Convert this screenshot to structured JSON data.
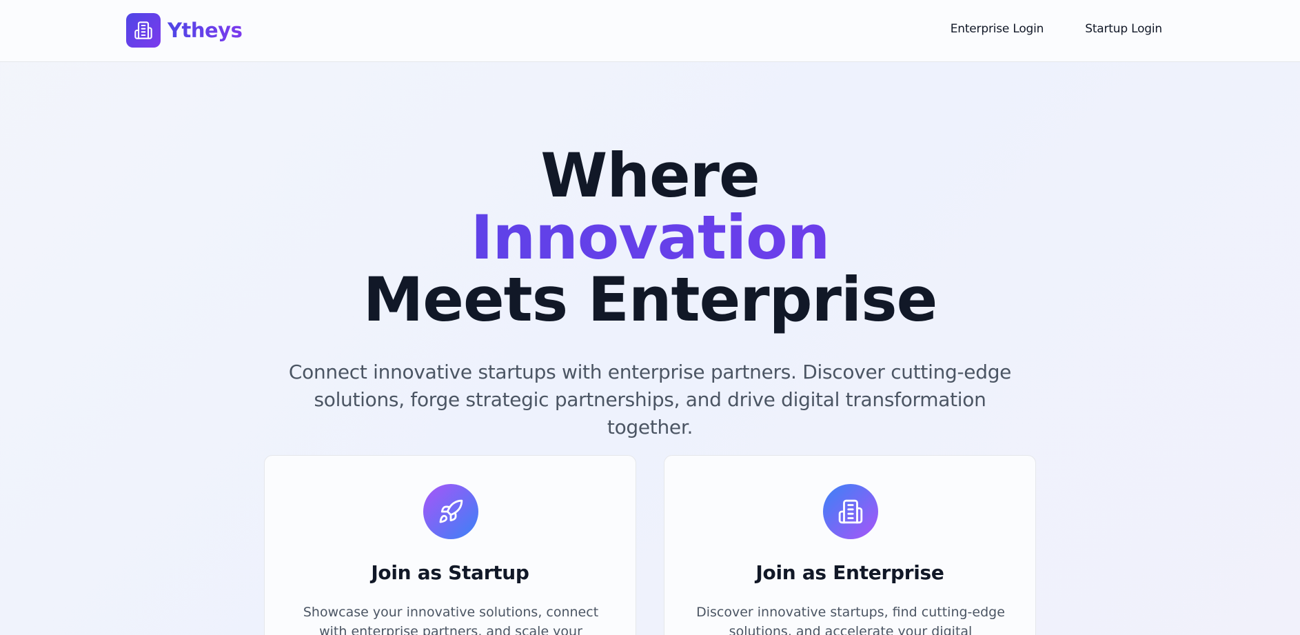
{
  "brand": {
    "name": "Ytheys",
    "logo_icon": "building-icon"
  },
  "nav": {
    "enterprise_login": "Enterprise Login",
    "startup_login": "Startup Login"
  },
  "hero": {
    "line1": "Where",
    "line2": "Innovation",
    "line3": "Meets Enterprise",
    "subtitle": "Connect innovative startups with enterprise partners. Discover cutting-edge solutions, forge strategic partnerships, and drive digital transformation together."
  },
  "cards": [
    {
      "icon": "rocket-icon",
      "title": "Join as Startup",
      "description": "Showcase your innovative solutions, connect with enterprise partners, and scale your business with"
    },
    {
      "icon": "building-icon",
      "title": "Join as Enterprise",
      "description": "Discover innovative startups, find cutting-edge solutions, and accelerate your digital"
    }
  ],
  "colors": {
    "accent_start": "#4f46e5",
    "accent_end": "#7c3aed",
    "heading": "#111827",
    "body_text": "#4b5563"
  }
}
